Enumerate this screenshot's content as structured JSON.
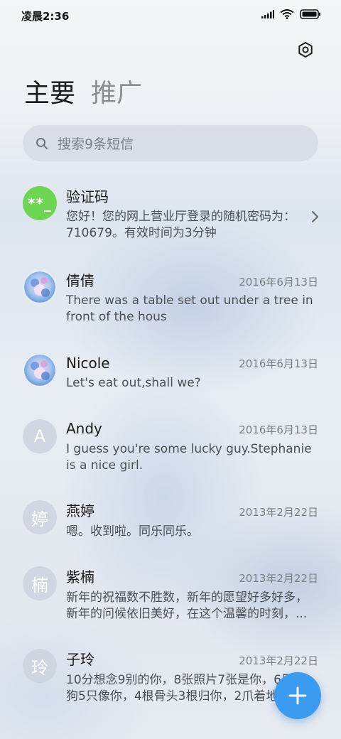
{
  "status_bar": {
    "time": "凌晨2:36",
    "icons": [
      "signal-icon",
      "wifi-icon",
      "battery-icon"
    ]
  },
  "header": {
    "settings_icon": "settings-icon",
    "tabs": [
      {
        "label": "主要",
        "active": true
      },
      {
        "label": "推广",
        "active": false
      }
    ]
  },
  "search": {
    "placeholder": "搜索9条短信"
  },
  "conversations": [
    {
      "avatar_type": "code",
      "avatar_text": "**_",
      "name": "验证码",
      "date": "",
      "preview": "您好！您的网上营业厅登录的随机密码为：710679。有效时间为3分钟",
      "has_chevron": true
    },
    {
      "avatar_type": "photo",
      "avatar_text": "",
      "name": "倩倩",
      "date": "2016年6月13日",
      "preview": "There was a table set out under a tree in front of the hous"
    },
    {
      "avatar_type": "photo",
      "avatar_text": "",
      "name": "Nicole",
      "date": "2016年6月13日",
      "preview": "Let's eat out,shall we?"
    },
    {
      "avatar_type": "letter",
      "avatar_text": "A",
      "name": "Andy",
      "date": "2016年6月13日",
      "preview": "I guess you're some lucky guy.Stephanie is a nice girl."
    },
    {
      "avatar_type": "letter",
      "avatar_text": "婷",
      "name": "燕婷",
      "date": "2013年2月22日",
      "preview": "嗯。收到啦。同乐同乐。"
    },
    {
      "avatar_type": "letter",
      "avatar_text": "楠",
      "name": "紫楠",
      "date": "2013年2月22日",
      "preview": "新年的祝福数不胜数，新年的愿望好多好多，新年的问候依旧美好，在这个温馨的时刻，..."
    },
    {
      "avatar_type": "letter",
      "avatar_text": "玲",
      "name": "子玲",
      "date": "2013年2月22日",
      "preview": "10分想念9别的你，8张照片7张是你，6只小狗5只像你，4根骨头3根归你，2爪着地"
    }
  ],
  "fab": {
    "icon": "plus-icon",
    "color": "#3b9bf0"
  },
  "colors": {
    "accent": "#3b9bf0",
    "code_avatar": "#6dd552"
  }
}
